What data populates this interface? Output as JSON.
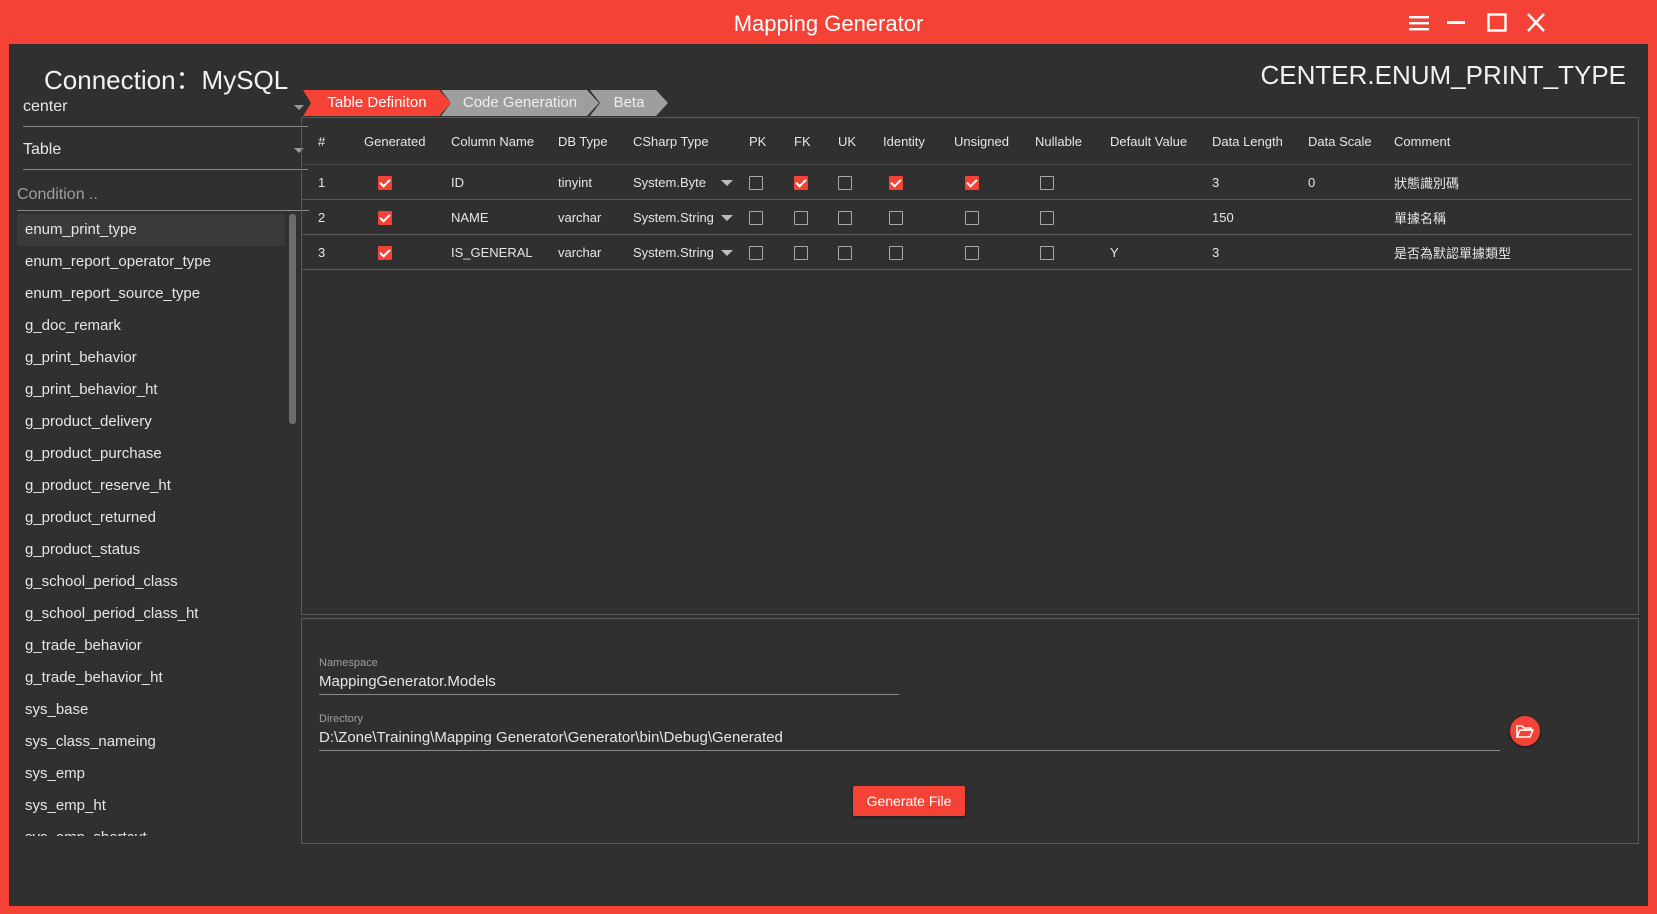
{
  "window": {
    "title": "Mapping Generator"
  },
  "header": {
    "connection_label": "Connection：MySQL",
    "table_title": "CENTER.ENUM_PRINT_TYPE"
  },
  "sidebar": {
    "database": "center",
    "object_type": "Table",
    "condition_placeholder": "Condition ..",
    "tables": [
      "enum_print_type",
      "enum_report_operator_type",
      "enum_report_source_type",
      "g_doc_remark",
      "g_print_behavior",
      "g_print_behavior_ht",
      "g_product_delivery",
      "g_product_purchase",
      "g_product_reserve_ht",
      "g_product_returned",
      "g_product_status",
      "g_school_period_class",
      "g_school_period_class_ht",
      "g_trade_behavior",
      "g_trade_behavior_ht",
      "sys_base",
      "sys_class_nameing",
      "sys_emp",
      "sys_emp_ht",
      "sys_emp_shortcut"
    ],
    "selected_index": 0
  },
  "tabs": [
    {
      "label": "Table Definiton",
      "active": true
    },
    {
      "label": "Code Generation",
      "active": false
    },
    {
      "label": "Beta",
      "active": false
    }
  ],
  "grid": {
    "columns": [
      "#",
      "Generated",
      "Column Name",
      "DB Type",
      "CSharp Type",
      "PK",
      "FK",
      "UK",
      "Identity",
      "Unsigned",
      "Nullable",
      "Default Value",
      "Data Length",
      "Data Scale",
      "Comment"
    ],
    "rows": [
      {
        "num": "1",
        "generated": true,
        "name": "ID",
        "db_type": "tinyint",
        "cs_type": "System.Byte",
        "pk": false,
        "fk": true,
        "uk": false,
        "identity": true,
        "unsigned": true,
        "nullable": false,
        "default": "",
        "length": "3",
        "scale": "0",
        "comment": "狀態識別碼"
      },
      {
        "num": "2",
        "generated": true,
        "name": "NAME",
        "db_type": "varchar",
        "cs_type": "System.String",
        "pk": false,
        "fk": false,
        "uk": false,
        "identity": false,
        "unsigned": false,
        "nullable": false,
        "default": "",
        "length": "150",
        "scale": "",
        "comment": "單據名稱"
      },
      {
        "num": "3",
        "generated": true,
        "name": "IS_GENERAL",
        "db_type": "varchar",
        "cs_type": "System.String",
        "pk": false,
        "fk": false,
        "uk": false,
        "identity": false,
        "unsigned": false,
        "nullable": false,
        "default": "Y",
        "length": "3",
        "scale": "",
        "comment": "是否為默認單據類型"
      }
    ]
  },
  "output": {
    "namespace_label": "Namespace",
    "namespace_value": "MappingGenerator.Models",
    "directory_label": "Directory",
    "directory_value": "D:\\Zone\\Training\\Mapping Generator\\Generator\\bin\\Debug\\Generated",
    "generate_label": "Generate File"
  },
  "colors": {
    "accent": "#f44336",
    "background": "#303030",
    "inactive_tab": "#9e9e9e"
  }
}
